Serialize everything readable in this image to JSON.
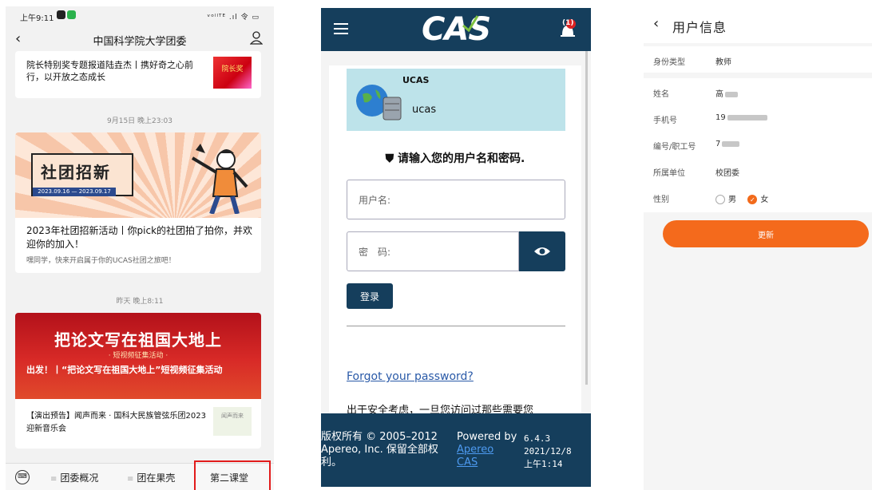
{
  "panel1": {
    "status": {
      "time": "上午9:11",
      "signal": "ᵛᵒˡˡᵀᴱ .ıl 令 ▭"
    },
    "nav": {
      "title": "中国科学院大学团委"
    },
    "articles": [
      {
        "title": "院长特别奖专题报道陆垚杰丨携好奇之心前行，以开放之态成长",
        "thumb": "院长奖"
      },
      {
        "date": "9月15日 晚上23:03",
        "banner": "社团招新",
        "banner_date": "2023.09.16 — 2023.09.17",
        "title": "2023年社团招新活动丨你pick的社团拍了拍你，并欢迎你的加入！",
        "summary": "嘿同学，快来开启属于你的UCAS社团之旅吧！"
      },
      {
        "date": "昨天 晚上8:11",
        "banner": "把论文写在祖国大地上",
        "banner_sub": "· 短视频征集活动 ·",
        "overlay": "出发！丨“把论文写在祖国大地上”短视频征集活动",
        "title": "【演出预告】闻声而来 · 国科大民族管弦乐团2023迎新音乐会",
        "thumb": "闻声而来"
      }
    ],
    "tabs": [
      "团委概况",
      "团在果壳",
      "第二课堂"
    ]
  },
  "panel2": {
    "logo": "CAS",
    "badge": "(1)",
    "service": {
      "name": "UCAS",
      "label": "ucas"
    },
    "prompt": "请输入您的用户名和密码.",
    "username_placeholder": "用户名:",
    "password_placeholder": "密　码:",
    "login_label": "登录",
    "forgot_label": "Forgot your password?",
    "notice": "出于安全考虑，一旦您访问过那些需要您",
    "footer": {
      "copyright": "版权所有 © 2005–2012 Apereo, Inc. 保留全部权利。",
      "powered_prefix": "Powered by ",
      "powered_link": "Apereo CAS",
      "version": "6.4.3",
      "date": "2021/12/8",
      "time": "上午1:14"
    }
  },
  "panel3": {
    "title": "用户信息",
    "fields": [
      {
        "label": "身份类型",
        "value": "教师"
      },
      {
        "label": "姓名",
        "value": "高"
      },
      {
        "label": "手机号",
        "value": "19"
      },
      {
        "label": "编号/职工号",
        "value": "7"
      },
      {
        "label": "所属单位",
        "value": "校团委"
      },
      {
        "label": "性别",
        "options": [
          "男",
          "女"
        ],
        "selected": "女"
      }
    ],
    "update_label": "更新"
  },
  "colors": {
    "cas_navy": "#153e5c",
    "accent_orange": "#f46a1c",
    "highlight_red": "#e21b1b"
  }
}
